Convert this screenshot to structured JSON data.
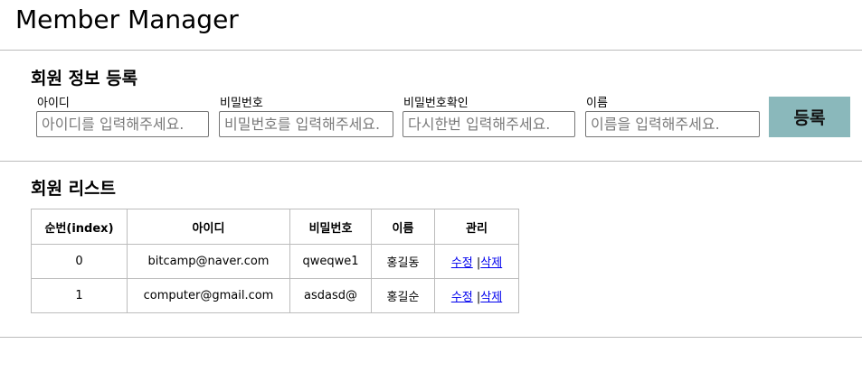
{
  "header": {
    "title": "Member Manager"
  },
  "register_section": {
    "title": "회원 정보 등록",
    "fields": [
      {
        "label": "아이디",
        "placeholder": "아이디를 입력해주세요.",
        "value": ""
      },
      {
        "label": "비밀번호",
        "placeholder": "비밀번호를 입력해주세요.",
        "value": ""
      },
      {
        "label": "비밀번호확인",
        "placeholder": "다시한번 입력해주세요.",
        "value": ""
      },
      {
        "label": "이름",
        "placeholder": "이름을 입력해주세요.",
        "value": ""
      }
    ],
    "submit_label": "등록",
    "submit_color": "#8ab8bb"
  },
  "list_section": {
    "title": "회원 리스트",
    "columns": [
      "순번(index)",
      "아이디",
      "비밀번호",
      "이름",
      "관리"
    ],
    "rows": [
      {
        "index": "0",
        "id": "bitcamp@naver.com",
        "password": "qweqwe1",
        "name": "홍길동",
        "edit": "수정",
        "separator": "|",
        "delete": "삭제"
      },
      {
        "index": "1",
        "id": "computer@gmail.com",
        "password": "asdasd@",
        "name": "홍길순",
        "edit": "수정",
        "separator": "|",
        "delete": "삭제"
      }
    ]
  },
  "colors": {
    "link": "#0000ee",
    "divider": "#bcbcbc"
  }
}
